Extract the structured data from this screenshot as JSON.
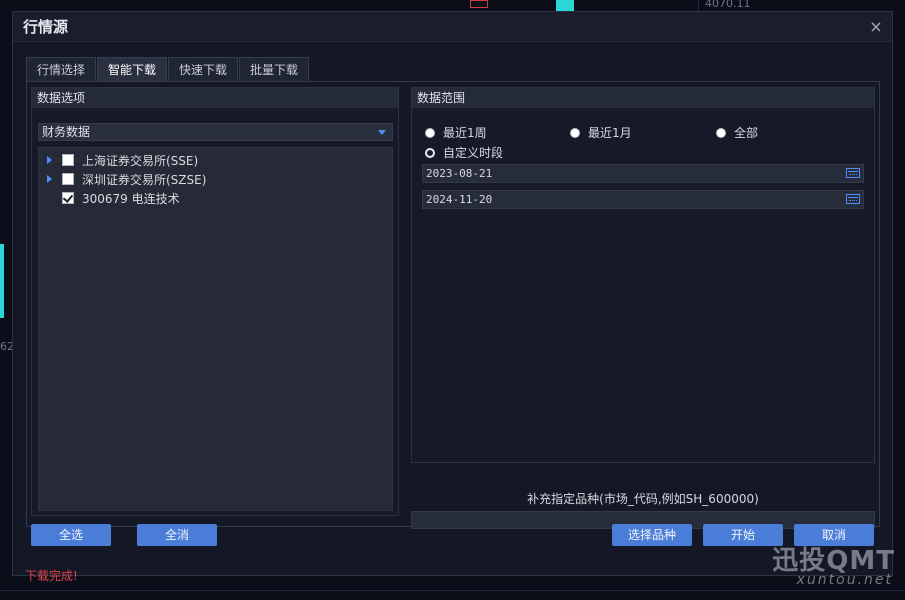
{
  "background": {
    "left_value": "62",
    "top_value": "4070.11"
  },
  "dialog": {
    "title": "行情源",
    "close_symbol": "×"
  },
  "tabs": [
    {
      "label": "行情选择"
    },
    {
      "label": "智能下载",
      "active": true
    },
    {
      "label": "快速下载"
    },
    {
      "label": "批量下载"
    }
  ],
  "left_panel": {
    "header": "数据选项",
    "select_value": "财务数据",
    "tree": [
      {
        "label": "上海证券交易所(SSE)",
        "expandable": true,
        "checked": false
      },
      {
        "label": "深圳证券交易所(SZSE)",
        "expandable": true,
        "checked": false
      },
      {
        "label": "300679 电连技术",
        "expandable": false,
        "checked": true
      }
    ]
  },
  "right_panel": {
    "header": "数据范围",
    "radios": [
      {
        "label": "最近1周",
        "selected": false
      },
      {
        "label": "最近1月",
        "selected": false
      },
      {
        "label": "全部",
        "selected": false
      },
      {
        "label": "自定义时段",
        "selected": true
      }
    ],
    "start_date": "2023-08-21",
    "end_date": "2024-11-20"
  },
  "supplement": {
    "hint": "补充指定品种(市场_代码,例如SH_600000)",
    "value": ""
  },
  "buttons": {
    "select_all": "全选",
    "deselect_all": "全消",
    "choose_symbols": "选择品种",
    "start": "开始",
    "cancel": "取消"
  },
  "status": "下载完成!",
  "status_color": "#e0434a",
  "accent_color": "#4a7dd8",
  "watermark": {
    "line1": "迅投QMT",
    "line2": "xuntou.net"
  }
}
